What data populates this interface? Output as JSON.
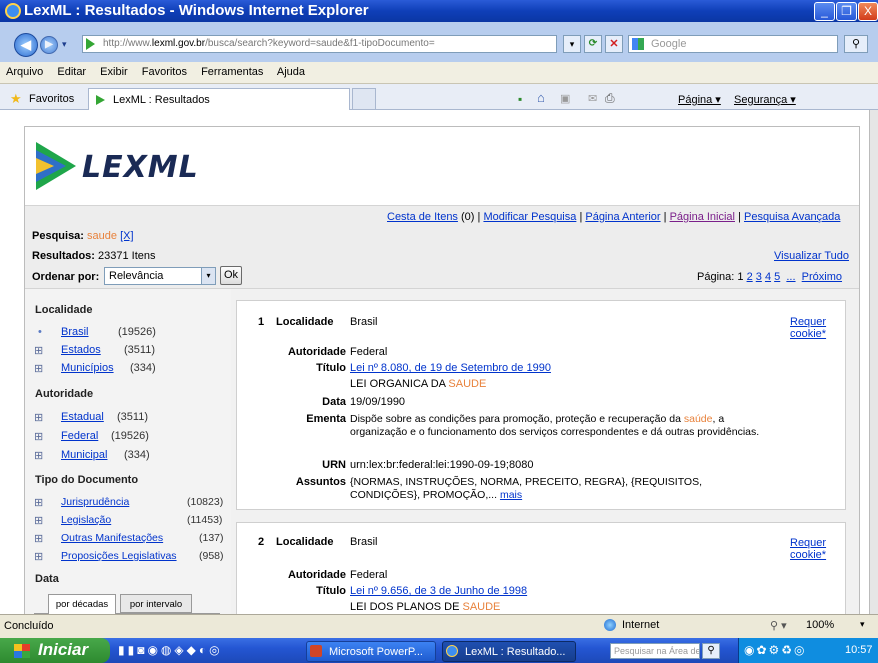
{
  "window": {
    "title": "LexML : Resultados - Windows Internet Explorer",
    "min_glyph": "_",
    "max_glyph": "❐",
    "close_glyph": "X"
  },
  "address": {
    "prefix": "http://www.",
    "domain": "lexml.gov.br",
    "path": "/busca/search?keyword=saude&f1-tipoDocumento=",
    "search_placeholder": "Google"
  },
  "menu": [
    "Arquivo",
    "Editar",
    "Exibir",
    "Favoritos",
    "Ferramentas",
    "Ajuda"
  ],
  "favorites_label": "Favoritos",
  "tab_title": "LexML : Resultados",
  "command_bar": {
    "page": "Página ▾",
    "security": "Segurança ▾"
  },
  "logo_text": "LEXML",
  "colors": {
    "accent_orange": "#e8823c",
    "link_blue": "#0033cc",
    "logo_navy": "#1a2a55"
  },
  "toolbar_links": {
    "cesta": "Cesta de Itens",
    "cesta_count": "(0)",
    "modificar": "Modificar Pesquisa",
    "anterior": "Página Anterior",
    "inicial": "Página Inicial",
    "avancada": "Pesquisa Avançada",
    "sep": "|"
  },
  "search_info": {
    "pesquisa_label": "Pesquisa:",
    "term": "saude",
    "remove": "[X]",
    "resultados_label": "Resultados:",
    "resultados_value": "23371 Itens",
    "visualizar": "Visualizar Tudo",
    "ordenar_label": "Ordenar por:",
    "ordenar_value": "Relevância",
    "ok": "Ok",
    "pagina_label": "Página:",
    "pages": [
      "1",
      "2",
      "3",
      "4",
      "5"
    ],
    "ellipsis": "...",
    "proximo": "Próximo"
  },
  "sidebar": {
    "localidade": {
      "title": "Localidade",
      "items": [
        {
          "marker": "•",
          "label": "Brasil",
          "count": "(19526)"
        },
        {
          "marker": "⊞",
          "label": "Estados",
          "count": "(3511)"
        },
        {
          "marker": "⊞",
          "label": "Municípios",
          "count": "(334)"
        }
      ]
    },
    "autoridade": {
      "title": "Autoridade",
      "items": [
        {
          "marker": "⊞",
          "label": "Estadual",
          "count": "(3511)"
        },
        {
          "marker": "⊞",
          "label": "Federal",
          "count": "(19526)"
        },
        {
          "marker": "⊞",
          "label": "Municipal",
          "count": "(334)"
        }
      ]
    },
    "tipo": {
      "title": "Tipo do Documento",
      "items": [
        {
          "marker": "⊞",
          "label": "Jurisprudência",
          "count": "(10823)"
        },
        {
          "marker": "⊞",
          "label": "Legislação",
          "count": "(11453)"
        },
        {
          "marker": "⊞",
          "label": "Outras Manifestações",
          "count": "(137)"
        },
        {
          "marker": "⊞",
          "label": "Proposições Legislativas",
          "count": "(958)"
        }
      ]
    },
    "data": {
      "title": "Data",
      "tab1": "por décadas",
      "tab2": "por intervalo"
    }
  },
  "results": [
    {
      "num": "1",
      "localidade_label": "Localidade",
      "localidade": "Brasil",
      "requer1": "Requer",
      "requer2": "cookie*",
      "autoridade_label": "Autoridade",
      "autoridade": "Federal",
      "titulo_label": "Título",
      "titulo": "Lei nº 8.080, de 19 de Setembro de 1990",
      "subtitulo_pre": "LEI ORGANICA DA ",
      "subtitulo_hl": "SAUDE",
      "data_label": "Data",
      "data": "19/09/1990",
      "ementa_label": "Ementa",
      "ementa_pre": "Dispõe sobre as condições para promoção, proteção e recuperação da ",
      "ementa_hl": "saúde",
      "ementa_post": ", a organização e o funcionamento dos serviços correspondentes e dá outras providências.",
      "urn_label": "URN",
      "urn": "urn:lex:br:federal:lei:1990-09-19;8080",
      "assuntos_label": "Assuntos",
      "assuntos": "{NORMAS, INSTRUÇÕES, NORMA, PRECEITO, REGRA}, {REQUISITOS, CONDIÇÕES}, PROMOÇÃO,... ",
      "mais": "mais"
    },
    {
      "num": "2",
      "localidade_label": "Localidade",
      "localidade": "Brasil",
      "requer1": "Requer",
      "requer2": "cookie*",
      "autoridade_label": "Autoridade",
      "autoridade": "Federal",
      "titulo_label": "Título",
      "titulo": "Lei nº 9.656, de 3 de Junho de 1998",
      "subtitulo_pre": "LEI DOS PLANOS DE ",
      "subtitulo_hl": "SAUDE"
    }
  ],
  "status": {
    "left": "Concluído",
    "zone": "Internet",
    "zoom": "100%"
  },
  "taskbar": {
    "start": "Iniciar",
    "task1": "Microsoft PowerP...",
    "task2": "LexML : Resultado...",
    "search_placeholder": "Pesquisar na Área de ...",
    "clock": "10:57"
  }
}
